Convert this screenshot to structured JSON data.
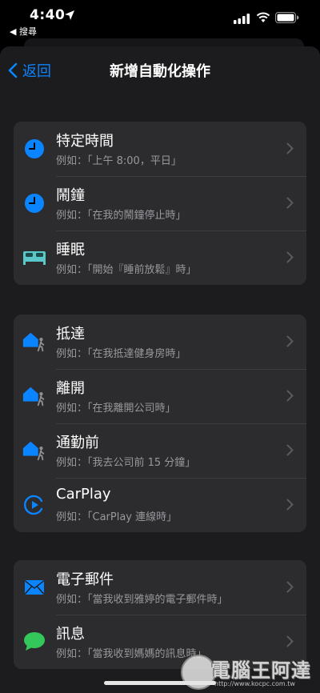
{
  "status_bar": {
    "time": "4:40",
    "back_app": "◀ 搜尋"
  },
  "nav": {
    "back_label": "返回",
    "title": "新增自動化操作"
  },
  "groups": [
    {
      "items": [
        {
          "icon": "clock-icon",
          "title": "特定時間",
          "subtitle": "例如：「上午 8:00，平日」"
        },
        {
          "icon": "alarm-icon",
          "title": "鬧鐘",
          "subtitle": "例如：「在我的鬧鐘停止時」"
        },
        {
          "icon": "bed-icon",
          "title": "睡眠",
          "subtitle": "例如：「開始『睡前放鬆』時」"
        }
      ]
    },
    {
      "items": [
        {
          "icon": "home-person-icon",
          "title": "抵達",
          "subtitle": "例如：「在我抵達健身房時」"
        },
        {
          "icon": "home-person-icon",
          "title": "離開",
          "subtitle": "例如：「在我離開公司時」"
        },
        {
          "icon": "home-person-icon",
          "title": "通勤前",
          "subtitle": "例如：「我去公司前 15 分鐘」"
        },
        {
          "icon": "carplay-icon",
          "title": "CarPlay",
          "subtitle": "例如：「CarPlay 連線時」"
        }
      ]
    },
    {
      "items": [
        {
          "icon": "mail-icon",
          "title": "電子郵件",
          "subtitle": "例如：「當我收到雅婷的電子郵件時」"
        },
        {
          "icon": "message-icon",
          "title": "訊息",
          "subtitle": "例如：「當我收到媽媽的訊息時」"
        }
      ]
    }
  ],
  "watermark": {
    "text": "電腦王阿達",
    "url": "http://www.kocpc.com.tw"
  },
  "colors": {
    "accent": "#0a84ff",
    "sheet_bg": "#1c1c1e",
    "group_bg": "#2c2c2e",
    "subtitle": "#98989d",
    "bed": "#5ac8c8",
    "message": "#34c759"
  }
}
